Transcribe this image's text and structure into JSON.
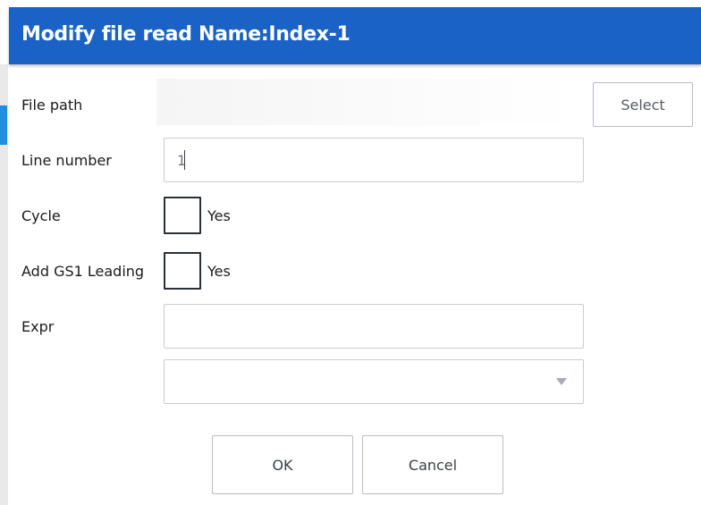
{
  "dialog": {
    "title": "Modify file read Name:Index-1"
  },
  "form": {
    "file_path": {
      "label": "File path",
      "select_button": "Select"
    },
    "line_number": {
      "label": "Line number",
      "value": "1"
    },
    "cycle": {
      "label": "Cycle",
      "checkbox_label": "Yes",
      "checked": false
    },
    "add_gs1_leading": {
      "label": "Add GS1 Leading",
      "checkbox_label": "Yes",
      "checked": false
    },
    "expr": {
      "label": "Expr",
      "value": "",
      "dropdown_value": ""
    }
  },
  "footer": {
    "ok_label": "OK",
    "cancel_label": "Cancel"
  },
  "colors": {
    "title_bar": "#1b62c6",
    "side_tab": "#1e8fe0"
  },
  "icons": {
    "dropdown": "chevron-down-icon"
  }
}
